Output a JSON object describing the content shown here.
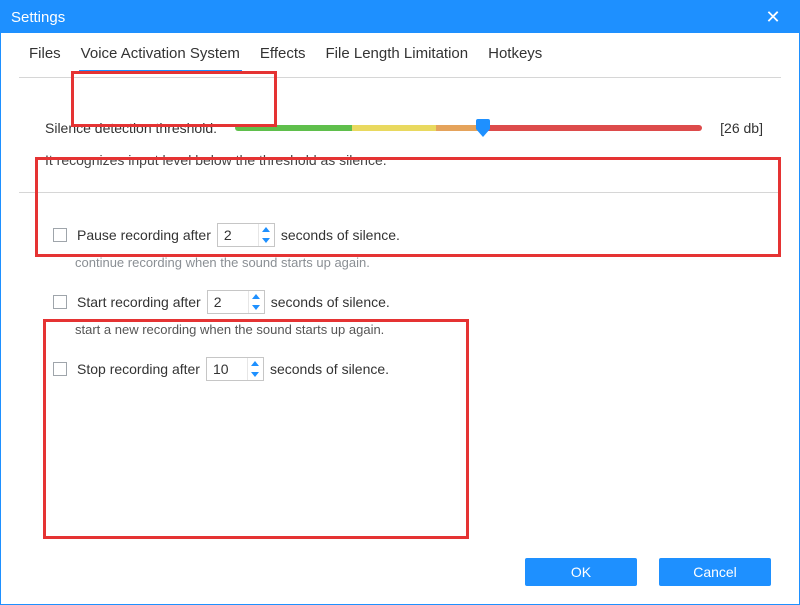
{
  "window": {
    "title": "Settings"
  },
  "tabs": {
    "files": "Files",
    "vas": "Voice Activation System",
    "effects": "Effects",
    "fll": "File Length Limitation",
    "hotkeys": "Hotkeys"
  },
  "threshold": {
    "label": "Silence detection threshold:",
    "value": "[26 db]",
    "help": "It recognizes input level below the threshold as silence."
  },
  "pause": {
    "prefix": "Pause recording after",
    "value": "2",
    "suffix": "seconds of silence.",
    "help": "continue recording when the sound starts up again."
  },
  "start": {
    "prefix": "Start recording after",
    "value": "2",
    "suffix": "seconds of silence.",
    "help": "start a new recording when the sound starts up again."
  },
  "stop": {
    "prefix": "Stop recording after",
    "value": "10",
    "suffix": "seconds of silence."
  },
  "footer": {
    "ok": "OK",
    "cancel": "Cancel"
  }
}
